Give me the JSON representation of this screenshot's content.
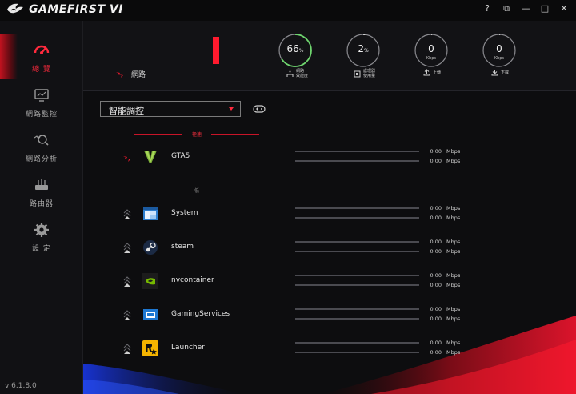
{
  "app": {
    "title": "GAMEFIRST VI",
    "version": "v 6.1.8.0"
  },
  "window_controls": {
    "help": "?",
    "restore": "⧉",
    "minimize": "—",
    "maximize": "□",
    "close": "✕"
  },
  "sidebar": {
    "items": [
      {
        "label": "總 覽",
        "icon": "dashboard-icon",
        "active": true
      },
      {
        "label": "網路監控",
        "icon": "monitor-icon",
        "active": false
      },
      {
        "label": "網路分析",
        "icon": "network-analysis-icon",
        "active": false
      },
      {
        "label": "路由器",
        "icon": "router-icon",
        "active": false
      },
      {
        "label": "設 定",
        "icon": "gear-icon",
        "active": false
      }
    ]
  },
  "top": {
    "network_label": "網路",
    "gauges": [
      {
        "value": "66",
        "suffix": "%",
        "unit": "",
        "caption": [
          "網路",
          "效能度"
        ],
        "fill": 0.66
      },
      {
        "value": "2",
        "suffix": "%",
        "unit": "",
        "caption": [
          "處理器",
          "使用量"
        ],
        "fill": 0.02
      },
      {
        "value": "0",
        "suffix": "",
        "unit": "Kbps",
        "caption": [
          "上傳"
        ],
        "fill": 0
      },
      {
        "value": "0",
        "suffix": "",
        "unit": "Kbps",
        "caption": [
          "下載"
        ],
        "fill": 0
      }
    ]
  },
  "main": {
    "mode": "智能調控",
    "sections": {
      "high": "極速",
      "low": "低"
    },
    "apps_high": [
      {
        "name": "GTA5",
        "icon": "gta-v-icon",
        "up": "0.00",
        "down": "0.00",
        "unit": "Mbps"
      }
    ],
    "apps_low": [
      {
        "name": "System",
        "icon": "system-window-icon",
        "up": "0.00",
        "down": "0.00",
        "unit": "Mbps"
      },
      {
        "name": "steam",
        "icon": "steam-icon",
        "up": "0.00",
        "down": "0.00",
        "unit": "Mbps"
      },
      {
        "name": "nvcontainer",
        "icon": "nvidia-icon",
        "up": "0.00",
        "down": "0.00",
        "unit": "Mbps"
      },
      {
        "name": "GamingServices",
        "icon": "gaming-services-icon",
        "up": "0.00",
        "down": "0.00",
        "unit": "Mbps"
      },
      {
        "name": "Launcher",
        "icon": "rockstar-icon",
        "up": "0.00",
        "down": "0.00",
        "unit": "Mbps"
      }
    ]
  },
  "colors": {
    "accent": "#ff1a2e",
    "gauge_green": "#6fd66f",
    "background": "#0d0d0f"
  }
}
